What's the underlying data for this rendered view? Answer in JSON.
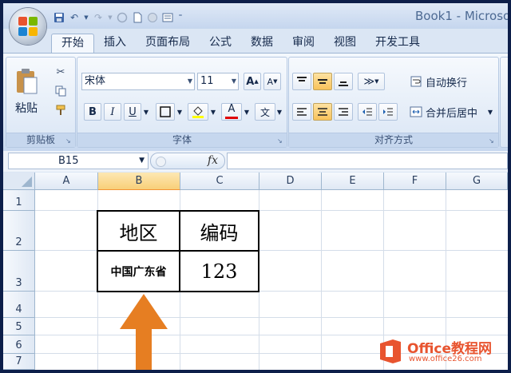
{
  "window": {
    "doc_title": "Book1 - Microso"
  },
  "tabs": [
    "开始",
    "插入",
    "页面布局",
    "公式",
    "数据",
    "审阅",
    "视图",
    "开发工具"
  ],
  "clipboard": {
    "paste_label": "粘贴",
    "group_label": "剪贴板"
  },
  "font": {
    "name": "宋体",
    "size": "11",
    "bold": "B",
    "italic": "I",
    "underline": "U",
    "grow": "A",
    "shrink": "A",
    "font_color_glyph": "A",
    "phonetic": "文",
    "group_label": "字体"
  },
  "alignment": {
    "wrap_text": "自动换行",
    "merge_center": "合并后居中",
    "group_label": "对齐方式"
  },
  "formula_bar": {
    "cell_ref": "B15",
    "fx": "fx",
    "value": ""
  },
  "columns": [
    "A",
    "B",
    "C",
    "D",
    "E",
    "F",
    "G"
  ],
  "rows": [
    "1",
    "2",
    "3",
    "4",
    "5",
    "6",
    "7"
  ],
  "cells": {
    "b2": "地区",
    "c2": "编码",
    "b3": "中国广东省",
    "c3": "123"
  },
  "watermark": {
    "brand": "Office教程网",
    "url": "www.office26.com"
  },
  "colors": {
    "accent_arrow": "#e67e22",
    "header_selected": "#f8cf79",
    "ribbon": "#dae6f5"
  }
}
